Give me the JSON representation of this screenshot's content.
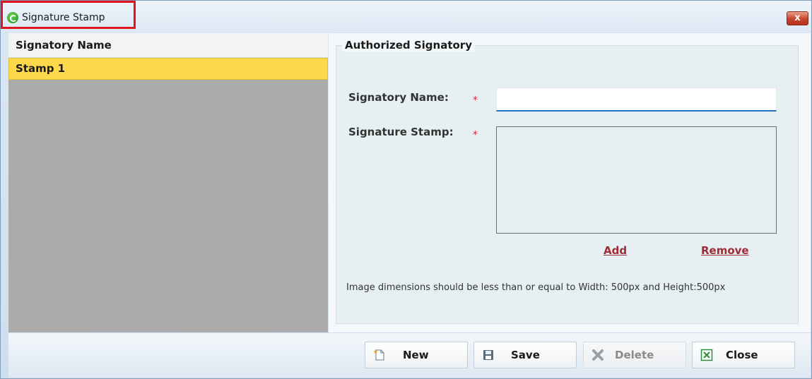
{
  "window": {
    "title": "Signature Stamp",
    "close_glyph": "x"
  },
  "list": {
    "header": "Signatory Name",
    "rows": [
      "Stamp 1"
    ]
  },
  "form": {
    "group_title": "Authorized Signatory",
    "name_label": "Signatory Name:",
    "stamp_label": "Signature Stamp:",
    "required_mark": "⁎",
    "name_value": "",
    "add_link": "Add",
    "remove_link": "Remove",
    "hint": "Image dimensions should be less than or equal to Width: 500px and Height:500px"
  },
  "toolbar": {
    "new_label": "New",
    "save_label": "Save",
    "delete_label": "Delete",
    "close_label": "Close"
  },
  "icons": {
    "app": "app-logo-icon",
    "new": "new-document-icon",
    "save": "floppy-disk-icon",
    "delete": "delete-x-icon",
    "close": "close-box-icon"
  },
  "colors": {
    "selected_row": "#fdd94b",
    "link": "#9e2b35",
    "required": "#d0303a",
    "input_focus": "#1d6fc1",
    "highlight_box": "#e0161e"
  }
}
